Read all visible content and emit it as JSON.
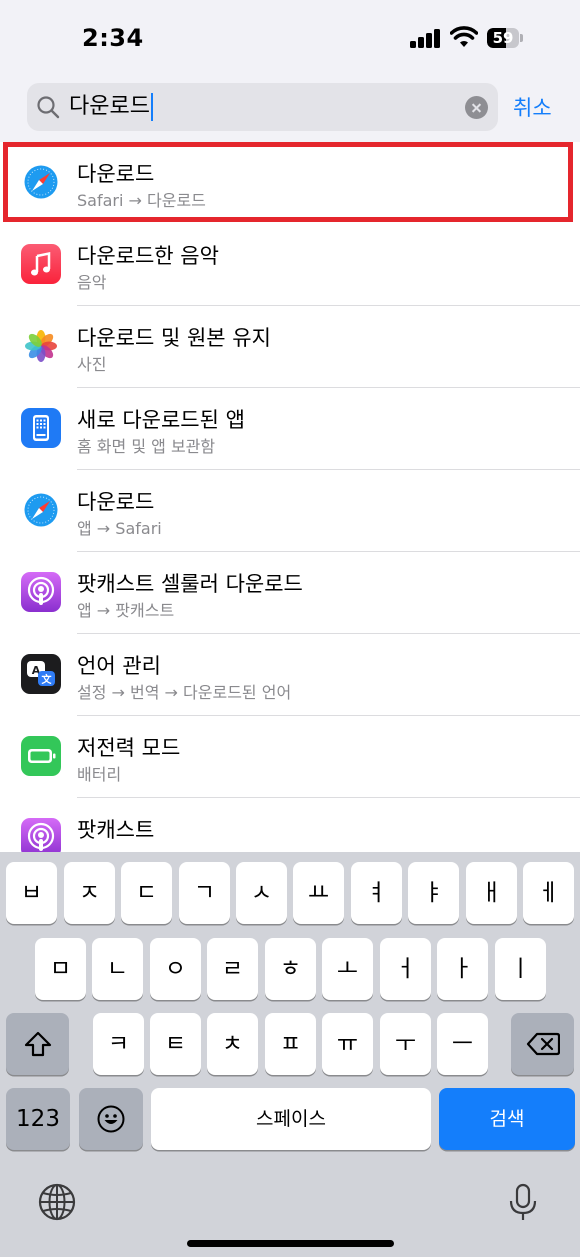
{
  "status_bar": {
    "time": "2:34",
    "battery": "59",
    "battery_level": 0.59
  },
  "search": {
    "query": "다운로드",
    "cancel_label": "취소"
  },
  "results": [
    {
      "title": "다운로드",
      "subtitle": "Safari → 다운로드",
      "icon": "safari-icon",
      "highlighted": true
    },
    {
      "title": "다운로드한 음악",
      "subtitle": "음악",
      "icon": "music-icon"
    },
    {
      "title": "다운로드 및 원본 유지",
      "subtitle": "사진",
      "icon": "photos-icon"
    },
    {
      "title": "새로 다운로드된 앱",
      "subtitle": "홈 화면 및 앱 보관함",
      "icon": "home-screen-icon"
    },
    {
      "title": "다운로드",
      "subtitle": "앱 → Safari",
      "icon": "safari-icon"
    },
    {
      "title": "팟캐스트 셀룰러 다운로드",
      "subtitle": "앱 → 팟캐스트",
      "icon": "podcasts-icon"
    },
    {
      "title": "언어 관리",
      "subtitle": "설정 → 번역 → 다운로드된 언어",
      "icon": "translate-icon"
    },
    {
      "title": "저전력 모드",
      "subtitle": "배터리",
      "icon": "battery-icon"
    },
    {
      "title": "팟캐스트",
      "subtitle": "",
      "icon": "podcasts-icon"
    }
  ],
  "keyboard": {
    "row1": [
      "ㅂ",
      "ㅈ",
      "ㄷ",
      "ㄱ",
      "ㅅ",
      "ㅛ",
      "ㅕ",
      "ㅑ",
      "ㅐ",
      "ㅔ"
    ],
    "row2": [
      "ㅁ",
      "ㄴ",
      "ㅇ",
      "ㄹ",
      "ㅎ",
      "ㅗ",
      "ㅓ",
      "ㅏ",
      "ㅣ"
    ],
    "row3": [
      "ㅋ",
      "ㅌ",
      "ㅊ",
      "ㅍ",
      "ㅠ",
      "ㅜ",
      "ㅡ"
    ],
    "numbers_label": "123",
    "space_label": "스페이스",
    "return_label": "검색",
    "accent_color": "#147efb"
  }
}
